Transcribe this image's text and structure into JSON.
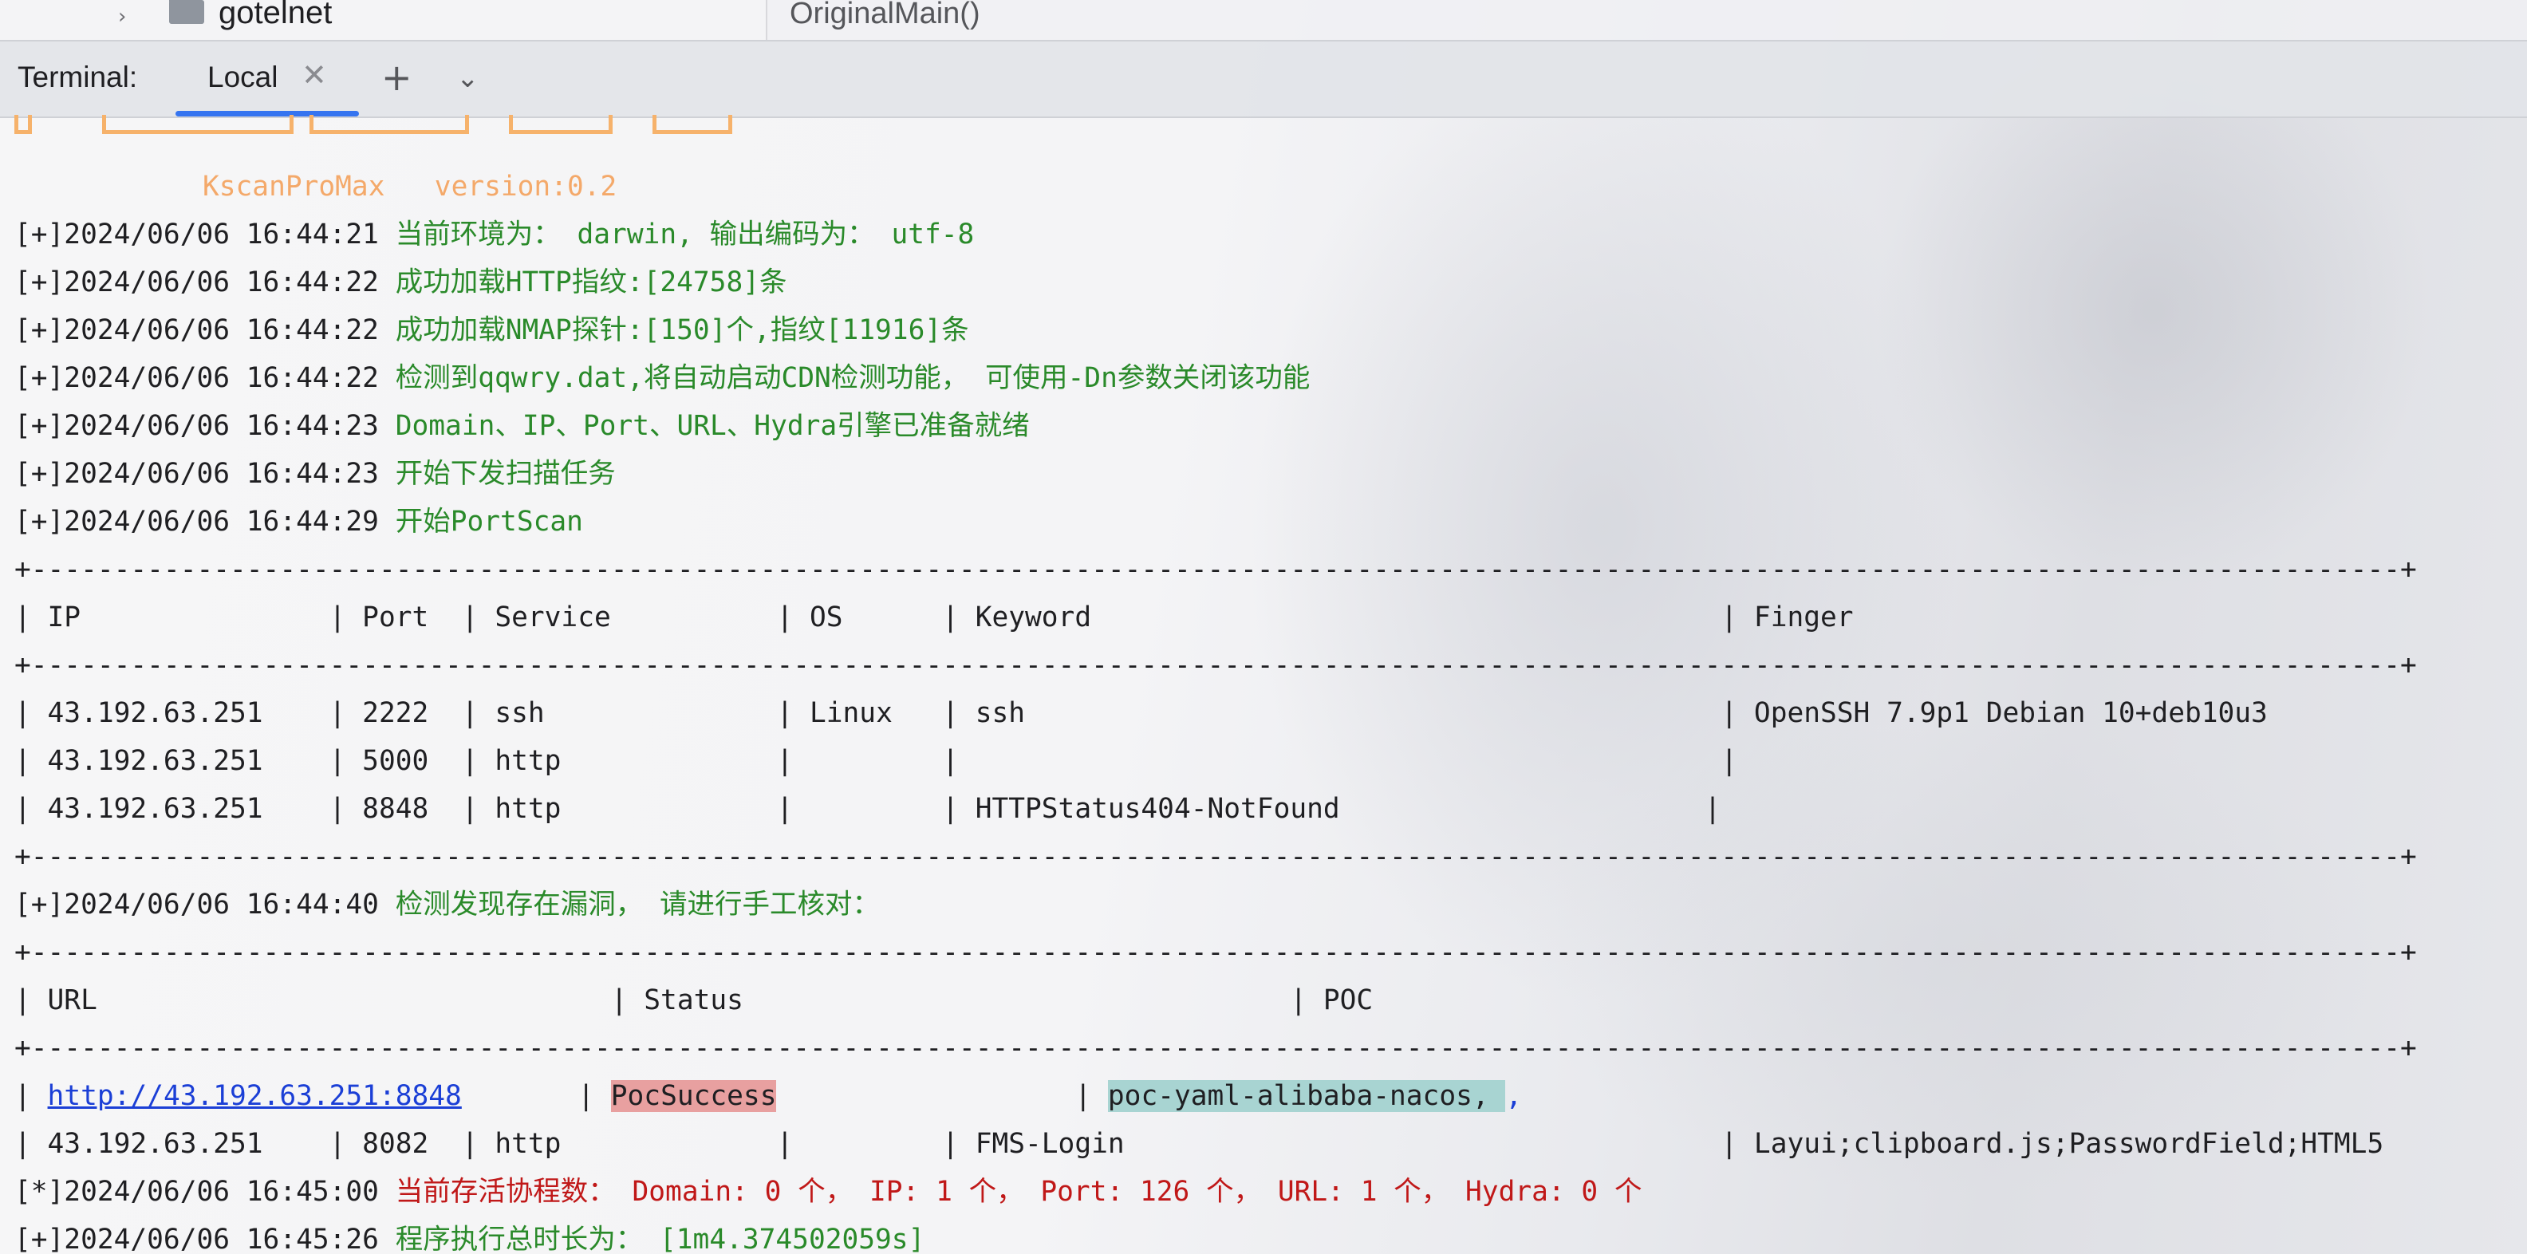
{
  "topbar": {
    "tree_item": "gotelnet",
    "editor_breadcrumb": "OriginalMain()"
  },
  "terminal": {
    "title": "Terminal:",
    "tab_label": "Local",
    "close_glyph": "✕",
    "plus_glyph": "+",
    "dropdown_glyph": "⌄"
  },
  "banner": {
    "tool_name": "KscanProMax",
    "version": "version:0.2"
  },
  "log_lines": [
    {
      "prefix": "[+]2024/06/06 16:44:21 ",
      "msg": "当前环境为： darwin, 输出编码为： utf-8"
    },
    {
      "prefix": "[+]2024/06/06 16:44:22 ",
      "msg": "成功加载HTTP指纹:[24758]条"
    },
    {
      "prefix": "[+]2024/06/06 16:44:22 ",
      "msg": "成功加载NMAP探针:[150]个,指纹[11916]条"
    },
    {
      "prefix": "[+]2024/06/06 16:44:22 ",
      "msg": "检测到qqwry.dat,将自动启动CDN检测功能， 可使用-Dn参数关闭该功能"
    },
    {
      "prefix": "[+]2024/06/06 16:44:23 ",
      "msg": "Domain、IP、Port、URL、Hydra引擎已准备就绪"
    },
    {
      "prefix": "[+]2024/06/06 16:44:23 ",
      "msg": "开始下发扫描任务"
    },
    {
      "prefix": "[+]2024/06/06 16:44:29 ",
      "msg": "开始PortScan"
    }
  ],
  "port_table": {
    "border": "+-----------------------------------------------------------------------------------------------------------------------------------------------+",
    "header": "| IP               | Port  | Service          | OS      | Keyword                                      | Finger",
    "rows": [
      "| 43.192.63.251    | 2222  | ssh              | Linux   | ssh                                          | OpenSSH 7.9p1 Debian 10+deb10u3",
      "| 43.192.63.251    | 5000  | http             |         |                                              |",
      "| 43.192.63.251    | 8848  | http             |         | HTTPStatus404-NotFound                      |"
    ]
  },
  "vuln_line": {
    "prefix": "[+]2024/06/06 16:44:40 ",
    "msg": "检测发现存在漏洞， 请进行手工核对："
  },
  "vuln_table": {
    "border": "+-----------------------------------------------------------------------------------------------------------------------------------------------+",
    "header": "| URL                               | Status                                 | POC",
    "row": {
      "lead": "| ",
      "url": "http://43.192.63.251:8848",
      "sep1": "       | ",
      "status": "PocSuccess",
      "sep2": "                  | ",
      "poc": "poc-yaml-alibaba-nacos, ",
      "tail": ","
    }
  },
  "extra_row": "| 43.192.63.251    | 8082  | http             |         | FMS-Login                                    | Layui;clipboard.js;PasswordField;HTML5",
  "status_line": {
    "prefix": "[*]2024/06/06 16:45:00 ",
    "msg": "当前存活协程数： Domain: 0 个， IP: 1 个， Port: 126 个， URL: 1 个， Hydra: 0 个"
  },
  "final_line": {
    "prefix": "[+]2024/06/06 16:45:26 ",
    "msg": "程序执行总时长为： [1m4.374502059s]"
  },
  "colors": {
    "log_green": "#2a8a2a",
    "status_red": "#c01818",
    "banner_orange": "#f4a96a",
    "tab_accent": "#3574f0",
    "pocsuccess_bg": "#e8a0a0",
    "poc_bg": "#a8d4d2"
  }
}
